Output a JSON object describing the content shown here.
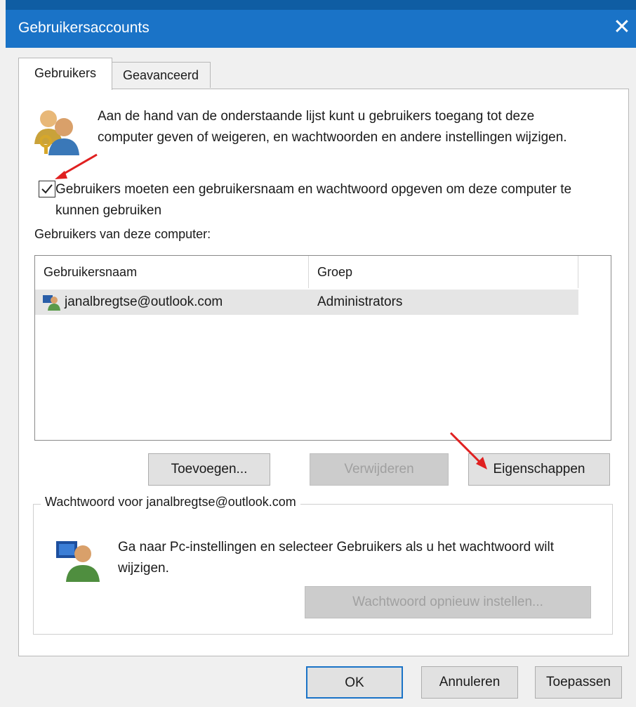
{
  "window": {
    "title": "Gebruikersaccounts",
    "close_glyph": "✕"
  },
  "tabs": [
    {
      "label": "Gebruikers",
      "active": true
    },
    {
      "label": "Geavanceerd",
      "active": false
    }
  ],
  "intro_text": "Aan de hand van de onderstaande lijst kunt u gebruikers toegang tot deze computer geven of weigeren, en wachtwoorden en andere instellingen wijzigen.",
  "require_login": {
    "checked": true,
    "label": "Gebruikers moeten een gebruikersnaam en wachtwoord opgeven om deze computer te kunnen gebruiken"
  },
  "user_list": {
    "caption": "Gebruikers van deze computer:",
    "columns": [
      "Gebruikersnaam",
      "Groep"
    ],
    "rows": [
      {
        "name": "janalbregtse@outlook.com",
        "group": "Administrators",
        "selected": true
      }
    ]
  },
  "list_buttons": {
    "add": "Toevoegen...",
    "remove": "Verwijderen",
    "properties": "Eigenschappen"
  },
  "password_group": {
    "label": "Wachtwoord voor janalbregtse@outlook.com",
    "text": "Ga naar Pc-instellingen en selecteer Gebruikers als u het wachtwoord wilt wijzigen.",
    "reset_button": "Wachtwoord opnieuw instellen..."
  },
  "footer_buttons": {
    "ok": "OK",
    "cancel": "Annuleren",
    "apply": "Toepassen"
  },
  "colors": {
    "titlebar": "#1a73c7",
    "annotation_arrow": "#e02020"
  }
}
